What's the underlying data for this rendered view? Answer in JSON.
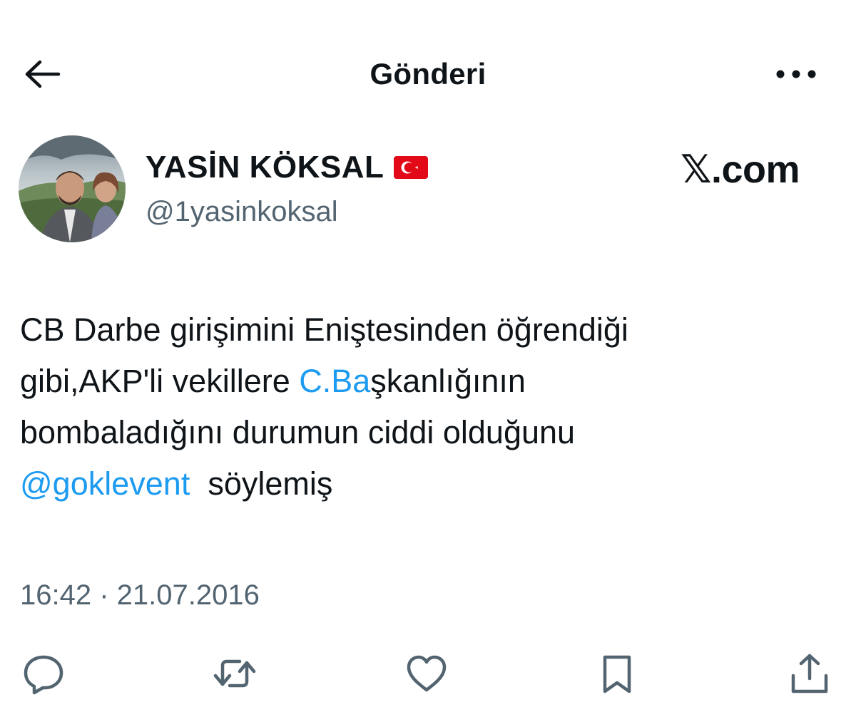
{
  "header": {
    "title": "Gönderi",
    "back_icon": "arrow-left-icon",
    "more_icon": "more-horizontal-icon"
  },
  "author": {
    "display_name": "YASİN KÖKSAL",
    "flag_icon": "turkey-flag-icon",
    "handle": "@1yasinkoksal"
  },
  "watermark": {
    "text": "𝕏.com"
  },
  "tweet": {
    "line1": "CB Darbe girişimini Eniştesinden öğrendiği",
    "line2_prefix": "gibi,AKP'li vekillere ",
    "line2_link": "C.Ba",
    "line2_suffix": "şkanlığının",
    "line3": "bombaladığını durumun ciddi olduğunu",
    "line4_mention": "@goklevent",
    "line4_suffix": "  söylemiş"
  },
  "timestamp": "16:42 · 21.07.2016",
  "actions": {
    "reply_icon": "reply-icon",
    "retweet_icon": "retweet-icon",
    "like_icon": "like-icon",
    "bookmark_icon": "bookmark-icon",
    "share_icon": "share-icon"
  },
  "colors": {
    "text": "#0f1419",
    "secondary": "#536471",
    "link": "#1d9bf0"
  }
}
